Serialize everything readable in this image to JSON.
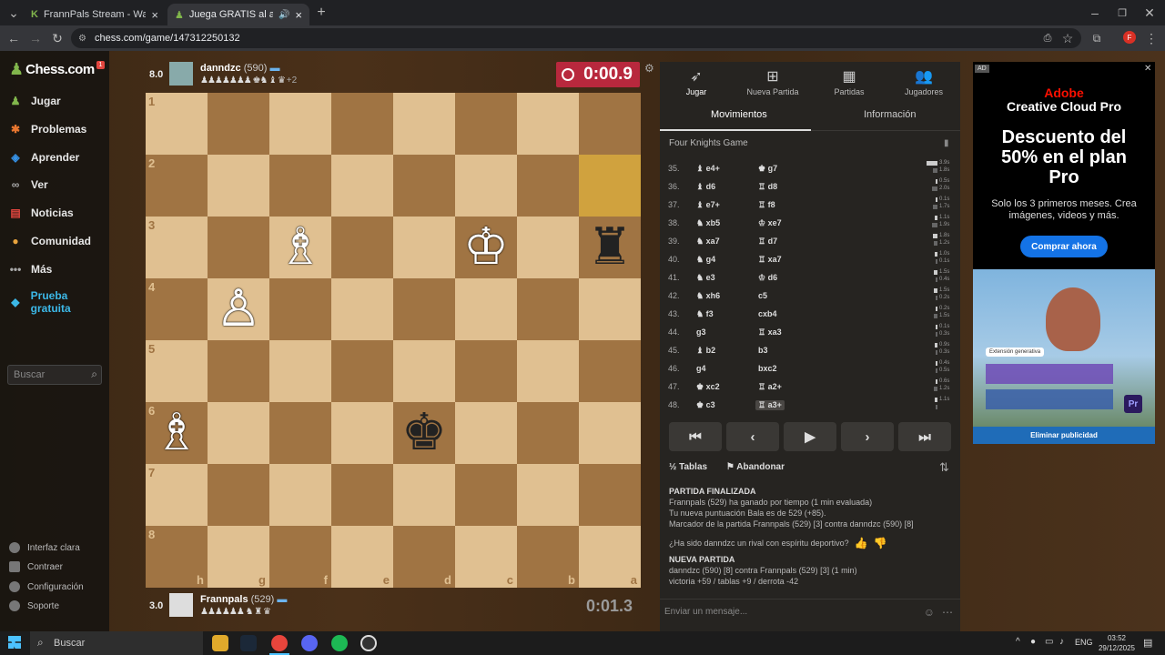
{
  "browser": {
    "tabs": [
      {
        "label": "FrannPals Stream - Watch Live o",
        "active": false
      },
      {
        "label": "Juega GRATIS al ajedrez onl",
        "active": true
      }
    ],
    "url": "chess.com/game/147312250132"
  },
  "sidebar": {
    "logo": "Chess.com",
    "notification_count": "1",
    "items": [
      {
        "label": "Jugar",
        "icon": "pawn-icon",
        "color": "#81b64c"
      },
      {
        "label": "Problemas",
        "icon": "puzzle-icon",
        "color": "#e8762f"
      },
      {
        "label": "Aprender",
        "icon": "learn-icon",
        "color": "#3692e7"
      },
      {
        "label": "Ver",
        "icon": "binoculars-icon",
        "color": "#aaaaaa"
      },
      {
        "label": "Noticias",
        "icon": "news-icon",
        "color": "#e2463f"
      },
      {
        "label": "Comunidad",
        "icon": "community-icon",
        "color": "#e8a33d"
      },
      {
        "label": "Más",
        "icon": "more-icon",
        "color": "#aaaaaa"
      }
    ],
    "trial_label": "Prueba gratuita",
    "search_placeholder": "Buscar",
    "bottom": [
      {
        "label": "Interfaz clara",
        "icon": "theme-icon"
      },
      {
        "label": "Contraer",
        "icon": "collapse-icon"
      },
      {
        "label": "Configuración",
        "icon": "settings-icon"
      },
      {
        "label": "Soporte",
        "icon": "help-icon"
      }
    ]
  },
  "top_player": {
    "eval": "8.0",
    "name": "danndzc",
    "rating": "(590)",
    "captured": "♟♟♟♟♟♟♟ ♚♞ ♝ ♛",
    "captured_extra": "+2",
    "clock": "0:00.9"
  },
  "bottom_player": {
    "eval": "3.0",
    "name": "Frannpals",
    "rating": "(529)",
    "captured": "♟♟♟♟♟♟ ♞ ♜ ♛",
    "clock": "0:01.3"
  },
  "board": {
    "ranks": [
      "1",
      "2",
      "3",
      "4",
      "5",
      "6",
      "7",
      "8"
    ],
    "files": [
      "h",
      "g",
      "f",
      "e",
      "d",
      "c",
      "b",
      "a"
    ],
    "pieces": [
      {
        "row": 2,
        "col": 2,
        "glyph": "♗",
        "color": "w"
      },
      {
        "row": 2,
        "col": 5,
        "glyph": "♔",
        "color": "w"
      },
      {
        "row": 2,
        "col": 7,
        "glyph": "♜",
        "color": "b"
      },
      {
        "row": 3,
        "col": 1,
        "glyph": "♙",
        "color": "w"
      },
      {
        "row": 5,
        "col": 0,
        "glyph": "♗",
        "color": "w"
      },
      {
        "row": 5,
        "col": 4,
        "glyph": "♚",
        "color": "b"
      }
    ],
    "highlight": [
      {
        "row": 1,
        "col": 7
      }
    ]
  },
  "panel": {
    "tabs": [
      {
        "label": "Jugar",
        "icon": "play-icon"
      },
      {
        "label": "Nueva Partida",
        "icon": "plus-icon"
      },
      {
        "label": "Partidas",
        "icon": "board-icon"
      },
      {
        "label": "Jugadores",
        "icon": "players-icon"
      }
    ],
    "subtabs": [
      "Movimientos",
      "Información"
    ],
    "opening": "Four Knights Game",
    "moves": [
      {
        "n": "35.",
        "w": "♝ e4+",
        "b": "♚ g7",
        "tw": "3.9s",
        "tb": "1.8s"
      },
      {
        "n": "36.",
        "w": "♝ d6",
        "b": "♖ d8",
        "tw": "0.5s",
        "tb": "2.0s"
      },
      {
        "n": "37.",
        "w": "♝ e7+",
        "b": "♖ f8",
        "tw": "0.1s",
        "tb": "1.7s"
      },
      {
        "n": "38.",
        "w": "♞ xb5",
        "b": "♔ xe7",
        "tw": "1.1s",
        "tb": "1.9s"
      },
      {
        "n": "39.",
        "w": "♞ xa7",
        "b": "♖ d7",
        "tw": "1.8s",
        "tb": "1.2s"
      },
      {
        "n": "40.",
        "w": "♞ g4",
        "b": "♖ xa7",
        "tw": "1.0s",
        "tb": "0.1s"
      },
      {
        "n": "41.",
        "w": "♞ e3",
        "b": "♔ d6",
        "tw": "1.5s",
        "tb": "0.4s"
      },
      {
        "n": "42.",
        "w": "♞ xh6",
        "b": "c5",
        "tw": "1.5s",
        "tb": "0.2s"
      },
      {
        "n": "43.",
        "w": "♞ f3",
        "b": "cxb4",
        "tw": "0.2s",
        "tb": "1.5s"
      },
      {
        "n": "44.",
        "w": "g3",
        "b": "♖ xa3",
        "tw": "0.1s",
        "tb": "0.3s"
      },
      {
        "n": "45.",
        "w": "♝ b2",
        "b": "b3",
        "tw": "0.9s",
        "tb": "0.3s"
      },
      {
        "n": "46.",
        "w": "g4",
        "b": "bxc2",
        "tw": "0.4s",
        "tb": "0.5s"
      },
      {
        "n": "47.",
        "w": "♚ xc2",
        "b": "♖ a2+",
        "tw": "0.6s",
        "tb": "1.2s"
      },
      {
        "n": "48.",
        "w": "♚ c3",
        "b": "♖ a3+",
        "tw": "1.1s",
        "tb": ""
      }
    ],
    "controls": [
      "⏮",
      "‹",
      "▶",
      "›",
      "⏭"
    ],
    "draw_label": "Tablas",
    "resign_label": "Abandonar",
    "result": {
      "heading": "PARTIDA FINALIZADA",
      "line1": "Frannpals (529) ha ganado por tiempo (1 min evaluada)",
      "line2": "Tu nueva puntuación Bala es de 529 (+85).",
      "line3": "Marcador de la partida Frannpals (529) [3] contra danndzc (590) [8]",
      "sport_q": "¿Ha sido danndzc un rival con espíritu deportivo?",
      "new_heading": "NUEVA PARTIDA",
      "new_line1": "danndzc (590) [8] contra Frannpals (529) [3] (1 min)",
      "new_line2": "victoria +59 / tablas +9 / derrota -42"
    },
    "chat_placeholder": "Enviar un mensaje..."
  },
  "ad": {
    "badge": "AD",
    "brand": "Adobe",
    "product": "Creative Cloud Pro",
    "headline": "Descuento del 50% en el plan Pro",
    "sub": "Solo los 3 primeros meses. Crea imágenes, videos y más.",
    "cta": "Comprar ahora",
    "tag": "Extensión generativa",
    "remove": "Eliminar publicidad"
  },
  "taskbar": {
    "search": "Buscar",
    "lang": "ENG",
    "time": "03:52",
    "date": "29/12/2025"
  }
}
